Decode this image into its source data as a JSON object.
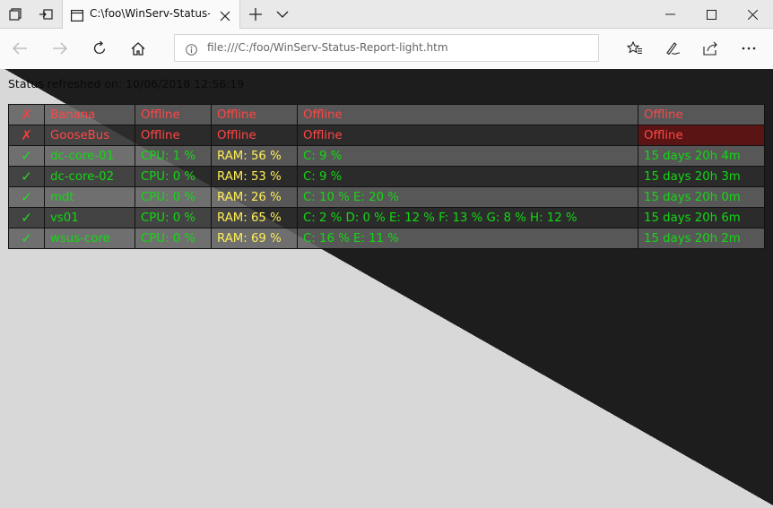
{
  "browser": {
    "tab_title": "C:\\foo\\WinServ-Status-R",
    "address": "file:///C:/foo/WinServ-Status-Report-light.htm",
    "icons": {
      "tab_manager": "tab-manager-icon",
      "set_aside": "set-aside-tabs-icon",
      "page": "page-icon",
      "close_tab": "close-icon",
      "new_tab": "plus-icon",
      "tab_preview": "chevron-down-icon",
      "minimize": "minimize-icon",
      "maximize": "maximize-icon",
      "close_window": "close-window-icon",
      "back": "back-arrow-icon",
      "forward": "forward-arrow-icon",
      "refresh": "refresh-icon",
      "home": "home-icon",
      "site_info": "info-icon",
      "favorites": "favorites-icon",
      "notes": "pen-icon",
      "share": "share-icon",
      "more": "more-icon"
    }
  },
  "report": {
    "refreshed_label": "Status refreshed on: 10/06/2018 12:56:19",
    "colors": {
      "online": "#12d812",
      "offline": "#ff4646",
      "ram": "#ffee55"
    },
    "servers": [
      {
        "status": "offline",
        "icon": "✗",
        "name": "Banana",
        "cpu": "Offline",
        "ram": "Offline",
        "disk": "Offline",
        "uptime": "Offline"
      },
      {
        "status": "offline",
        "icon": "✗",
        "name": "GooseBus",
        "cpu": "Offline",
        "ram": "Offline",
        "disk": "Offline",
        "uptime": "Offline"
      },
      {
        "status": "online",
        "icon": "✓",
        "name": "dc-core-01",
        "cpu": "CPU: 1 %",
        "ram": "RAM: 56 %",
        "disk": "C: 9 %",
        "uptime": "15 days 20h 4m"
      },
      {
        "status": "online",
        "icon": "✓",
        "name": "dc-core-02",
        "cpu": "CPU: 0 %",
        "ram": "RAM: 53 %",
        "disk": "C: 9 %",
        "uptime": "15 days 20h 3m"
      },
      {
        "status": "online",
        "icon": "✓",
        "name": "mdt",
        "cpu": "CPU: 0 %",
        "ram": "RAM: 26 %",
        "disk": "C: 10 % E: 20 %",
        "uptime": "15 days 20h 0m"
      },
      {
        "status": "online",
        "icon": "✓",
        "name": "vs01",
        "cpu": "CPU: 0 %",
        "ram": "RAM: 65 %",
        "disk": "C: 2 % D: 0 % E: 12 % F: 13 % G: 8 % H: 12 %",
        "uptime": "15 days 20h 6m"
      },
      {
        "status": "online",
        "icon": "✓",
        "name": "wsus-core",
        "cpu": "CPU: 0 %",
        "ram": "RAM: 69 %",
        "disk": "C: 16 % E: 11 %",
        "uptime": "15 days 20h 2m"
      }
    ]
  }
}
